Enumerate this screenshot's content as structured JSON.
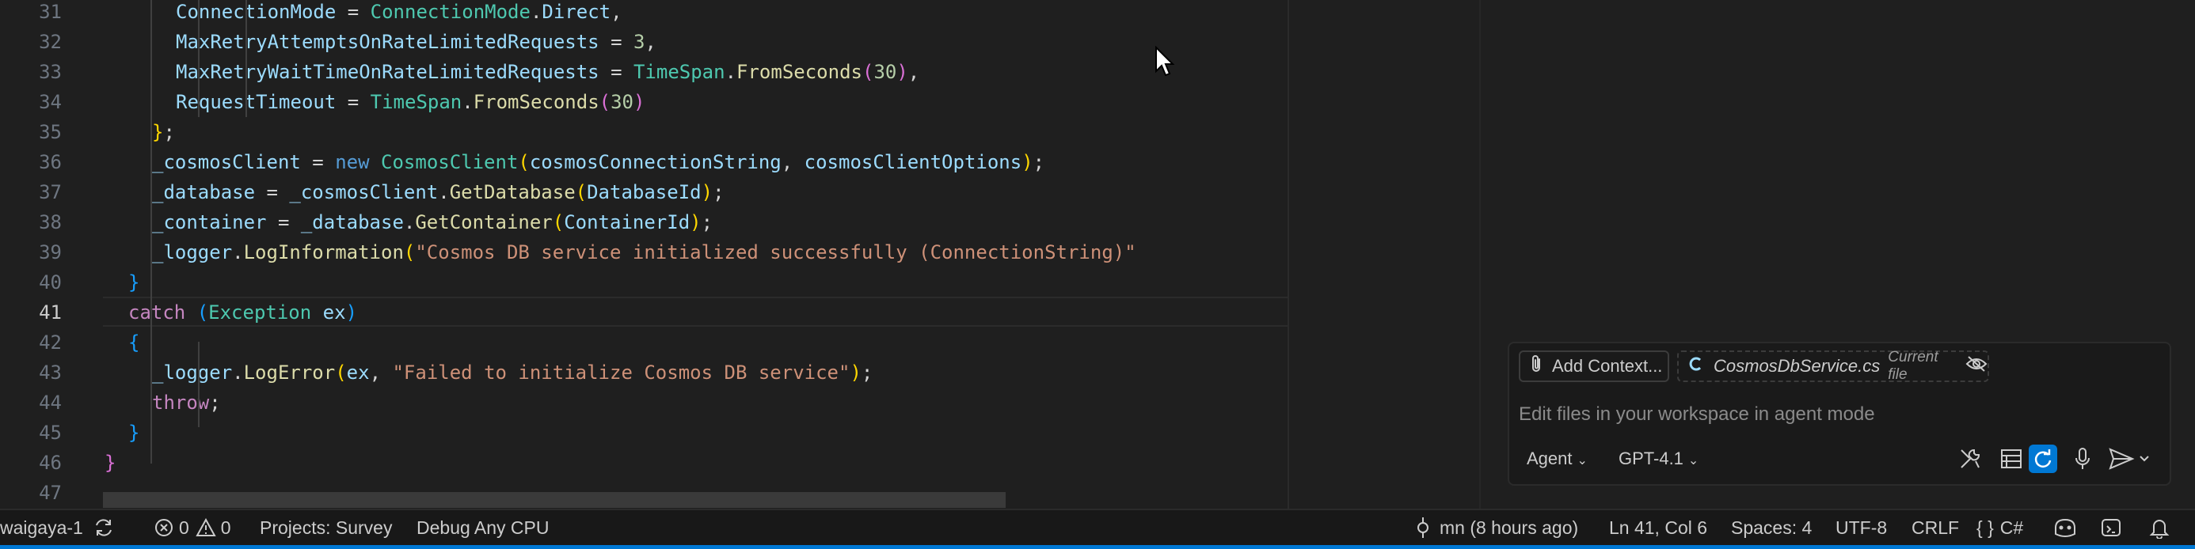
{
  "editor": {
    "current_line": "41",
    "lines": [
      {
        "n": "31",
        "t": [
          {
            "c": "t-var",
            "v": "ConnectionMode"
          },
          {
            "c": "t-op",
            "v": " = "
          },
          {
            "c": "t-type",
            "v": "ConnectionMode"
          },
          {
            "c": "t-op",
            "v": "."
          },
          {
            "c": "t-var",
            "v": "Direct"
          },
          {
            "c": "t-op",
            "v": ","
          }
        ]
      },
      {
        "n": "32",
        "t": [
          {
            "c": "t-var",
            "v": "MaxRetryAttemptsOnRateLimitedRequests"
          },
          {
            "c": "t-op",
            "v": " = "
          },
          {
            "c": "t-num",
            "v": "3"
          },
          {
            "c": "t-op",
            "v": ","
          }
        ]
      },
      {
        "n": "33",
        "t": [
          {
            "c": "t-var",
            "v": "MaxRetryWaitTimeOnRateLimitedRequests"
          },
          {
            "c": "t-op",
            "v": " = "
          },
          {
            "c": "t-type",
            "v": "TimeSpan"
          },
          {
            "c": "t-op",
            "v": "."
          },
          {
            "c": "t-fn",
            "v": "FromSeconds"
          },
          {
            "c": "t-b2",
            "v": "("
          },
          {
            "c": "t-num",
            "v": "30"
          },
          {
            "c": "t-b2",
            "v": ")"
          },
          {
            "c": "t-op",
            "v": ","
          }
        ]
      },
      {
        "n": "34",
        "t": [
          {
            "c": "t-var",
            "v": "RequestTimeout"
          },
          {
            "c": "t-op",
            "v": " = "
          },
          {
            "c": "t-type",
            "v": "TimeSpan"
          },
          {
            "c": "t-op",
            "v": "."
          },
          {
            "c": "t-fn",
            "v": "FromSeconds"
          },
          {
            "c": "t-b2",
            "v": "("
          },
          {
            "c": "t-num",
            "v": "30"
          },
          {
            "c": "t-b2",
            "v": ")"
          }
        ]
      },
      {
        "n": "35",
        "t": [
          {
            "c": "t-b1",
            "v": "}"
          },
          {
            "c": "t-op",
            "v": ";"
          }
        ]
      },
      {
        "n": "36",
        "t": [
          {
            "c": "t-var",
            "v": "_cosmosClient"
          },
          {
            "c": "t-op",
            "v": " = "
          },
          {
            "c": "t-kw",
            "v": "new"
          },
          {
            "c": "t-op",
            "v": " "
          },
          {
            "c": "t-type",
            "v": "CosmosClient"
          },
          {
            "c": "t-b1",
            "v": "("
          },
          {
            "c": "t-var",
            "v": "cosmosConnectionString"
          },
          {
            "c": "t-op",
            "v": ", "
          },
          {
            "c": "t-var",
            "v": "cosmosClientOptions"
          },
          {
            "c": "t-b1",
            "v": ")"
          },
          {
            "c": "t-op",
            "v": ";"
          }
        ]
      },
      {
        "n": "37",
        "t": [
          {
            "c": "t-var",
            "v": "_database"
          },
          {
            "c": "t-op",
            "v": " = "
          },
          {
            "c": "t-var",
            "v": "_cosmosClient"
          },
          {
            "c": "t-op",
            "v": "."
          },
          {
            "c": "t-fn",
            "v": "GetDatabase"
          },
          {
            "c": "t-b1",
            "v": "("
          },
          {
            "c": "t-var",
            "v": "DatabaseId"
          },
          {
            "c": "t-b1",
            "v": ")"
          },
          {
            "c": "t-op",
            "v": ";"
          }
        ]
      },
      {
        "n": "38",
        "t": [
          {
            "c": "t-var",
            "v": "_container"
          },
          {
            "c": "t-op",
            "v": " = "
          },
          {
            "c": "t-var",
            "v": "_database"
          },
          {
            "c": "t-op",
            "v": "."
          },
          {
            "c": "t-fn",
            "v": "GetContainer"
          },
          {
            "c": "t-b1",
            "v": "("
          },
          {
            "c": "t-var",
            "v": "ContainerId"
          },
          {
            "c": "t-b1",
            "v": ")"
          },
          {
            "c": "t-op",
            "v": ";"
          }
        ]
      },
      {
        "n": "39",
        "t": [
          {
            "c": "t-var",
            "v": "_logger"
          },
          {
            "c": "t-op",
            "v": "."
          },
          {
            "c": "t-fn",
            "v": "LogInformation"
          },
          {
            "c": "t-b1",
            "v": "("
          },
          {
            "c": "t-str",
            "v": "\"Cosmos DB service initialized successfully (ConnectionString)\""
          }
        ]
      },
      {
        "n": "40",
        "t": [
          {
            "c": "t-b3",
            "v": "}"
          }
        ]
      },
      {
        "n": "41",
        "t": [
          {
            "c": "t-ctl",
            "v": "catch"
          },
          {
            "c": "t-op",
            "v": " "
          },
          {
            "c": "t-b3",
            "v": "("
          },
          {
            "c": "t-type",
            "v": "Exception"
          },
          {
            "c": "t-op",
            "v": " "
          },
          {
            "c": "t-var",
            "v": "ex"
          },
          {
            "c": "t-b3",
            "v": ")"
          }
        ]
      },
      {
        "n": "42",
        "t": [
          {
            "c": "t-b3",
            "v": "{"
          }
        ]
      },
      {
        "n": "43",
        "t": [
          {
            "c": "t-var",
            "v": "_logger"
          },
          {
            "c": "t-op",
            "v": "."
          },
          {
            "c": "t-fn",
            "v": "LogError"
          },
          {
            "c": "t-b1",
            "v": "("
          },
          {
            "c": "t-var",
            "v": "ex"
          },
          {
            "c": "t-op",
            "v": ", "
          },
          {
            "c": "t-str",
            "v": "\"Failed to initialize Cosmos DB service\""
          },
          {
            "c": "t-b1",
            "v": ")"
          },
          {
            "c": "t-op",
            "v": ";"
          }
        ]
      },
      {
        "n": "44",
        "t": [
          {
            "c": "t-ctl",
            "v": "throw"
          },
          {
            "c": "t-op",
            "v": ";"
          }
        ]
      },
      {
        "n": "45",
        "t": [
          {
            "c": "t-b3",
            "v": "}"
          }
        ]
      },
      {
        "n": "46",
        "t": [
          {
            "c": "t-b2",
            "v": "}"
          }
        ]
      },
      {
        "n": "47",
        "t": []
      }
    ]
  },
  "chat": {
    "add_context_label": "Add Context...",
    "current_file_name": "CosmosDbService.cs",
    "current_file_tag": "Current file",
    "input_placeholder": "Edit files in your workspace in agent mode",
    "mode_label": "Agent",
    "model_label": "GPT-4.1"
  },
  "statusbar": {
    "branch": "waigaya-1",
    "errors": "0",
    "warnings": "0",
    "projects": "Projects: Survey",
    "debug": "Debug Any CPU",
    "git_blame": "mn (8 hours ago)",
    "cursor_position": "Ln 41, Col 6",
    "spaces": "Spaces: 4",
    "encoding": "UTF-8",
    "eol": "CRLF",
    "language_braces": "{ }",
    "language": "C#"
  },
  "colors": {
    "accent": "#0078d4",
    "editor_bg": "#1f1f1f",
    "statusbar_bg": "#181818"
  },
  "icons": [
    "sync-icon",
    "error-icon",
    "warning-icon",
    "git-commit-icon",
    "copilot-icon",
    "feedback-icon",
    "bell-icon",
    "paperclip-icon",
    "csharp-file-icon",
    "eye-off-icon",
    "tools-icon",
    "keyboard-icon",
    "refresh-icon",
    "mic-icon",
    "send-icon",
    "mouse-cursor-icon"
  ]
}
